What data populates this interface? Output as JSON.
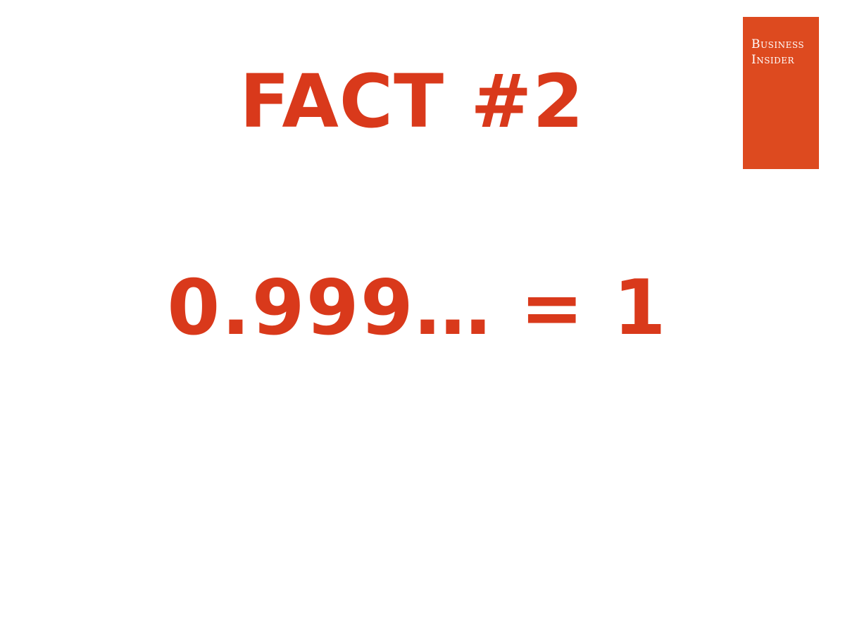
{
  "slide": {
    "headline": "FACT #2",
    "statement": "0.999… = 1"
  },
  "logo": {
    "line1": "Business",
    "line2": "Insider",
    "background_color": "#dd4a1f",
    "text_color": "#ffffff"
  },
  "colors": {
    "accent": "#d9391b",
    "background": "#ffffff"
  }
}
